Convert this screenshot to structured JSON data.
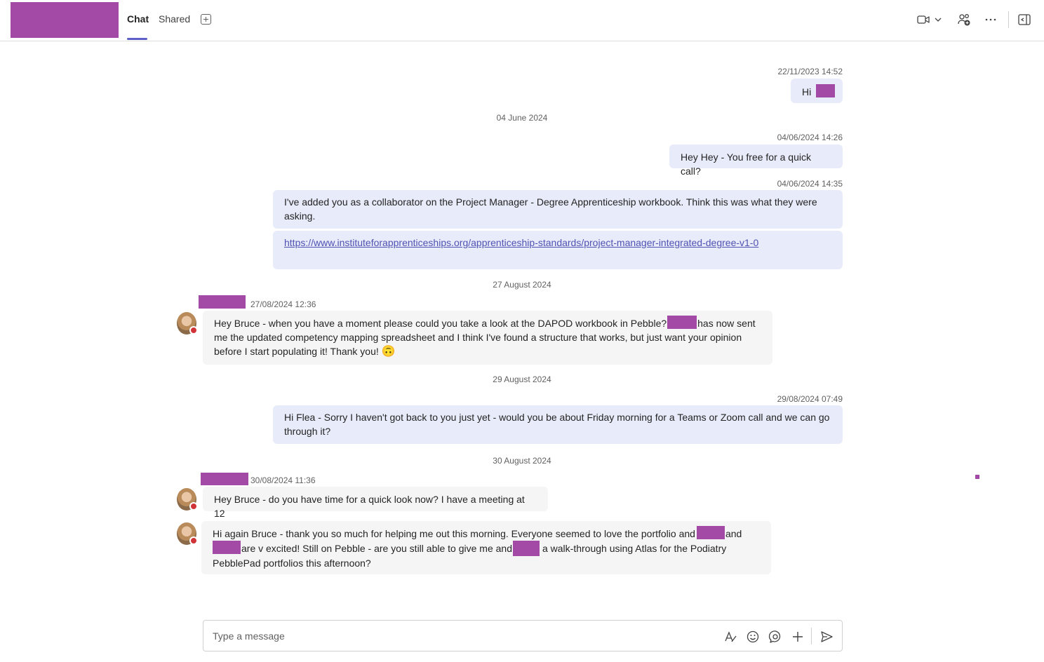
{
  "header": {
    "tabs": [
      {
        "label": "Chat",
        "active": true
      },
      {
        "label": "Shared",
        "active": false
      }
    ],
    "icons": [
      "video-call-icon",
      "chevron-down-icon",
      "people-add-icon",
      "more-options-icon",
      "open-side-panel-icon"
    ]
  },
  "colors": {
    "accent": "#5b5fc7",
    "redaction": "#a34aa6",
    "outgoing_bubble": "#e8ebfa",
    "incoming_bubble": "#f5f5f5",
    "presence_busy": "#d13438"
  },
  "messages": {
    "m1": {
      "timestamp": "22/11/2023 14:52",
      "text": "Hi"
    },
    "divider1": "04 June 2024",
    "m2": {
      "timestamp": "04/06/2024 14:26",
      "text": "Hey Hey - You free for a quick call?"
    },
    "m3": {
      "timestamp": "04/06/2024 14:35",
      "text": "I've added you as a collaborator on the Project Manager - Degree Apprenticeship workbook. Think this was what they were asking.",
      "link": "https://www.instituteforapprenticeships.org/apprenticeship-standards/project-manager-integrated-degree-v1-0"
    },
    "divider2": "27 August 2024",
    "m4": {
      "timestamp": "27/08/2024 12:36",
      "part1": "Hey Bruce - when you have a moment please could you take a look at the DAPOD workbook in Pebble?",
      "part2": "has now sent",
      "line2": "me the updated competency mapping spreadsheet and I think I've found a structure that works, but just want your opinion",
      "line3": "before I start populating it! Thank you!",
      "emoji": "🙃"
    },
    "divider3": "29 August 2024",
    "m5": {
      "timestamp": "29/08/2024 07:49",
      "text": "Hi Flea - Sorry I haven't got back to you just yet - would you be about Friday morning for a Teams or Zoom call and we can go through it?"
    },
    "divider4": "30 August 2024",
    "m6": {
      "timestamp": "30/08/2024 11:36",
      "text": "Hey Bruce - do you have time for a quick look now? I have a meeting at 12"
    },
    "m7": {
      "part1": "Hi again Bruce - thank you so much for helping me out this morning. Everyone seemed to love the portfolio and",
      "part2": "and",
      "part3": "are v excited! Still on Pebble - are you still able to give me and",
      "part4": "a walk-through using Atlas for the Podiatry",
      "line3": "PebblePad portfolios this afternoon?"
    }
  },
  "composer": {
    "placeholder": "Type a message",
    "icons": [
      "format-icon",
      "emoji-icon",
      "loop-icon",
      "plus-icon",
      "send-icon"
    ]
  }
}
